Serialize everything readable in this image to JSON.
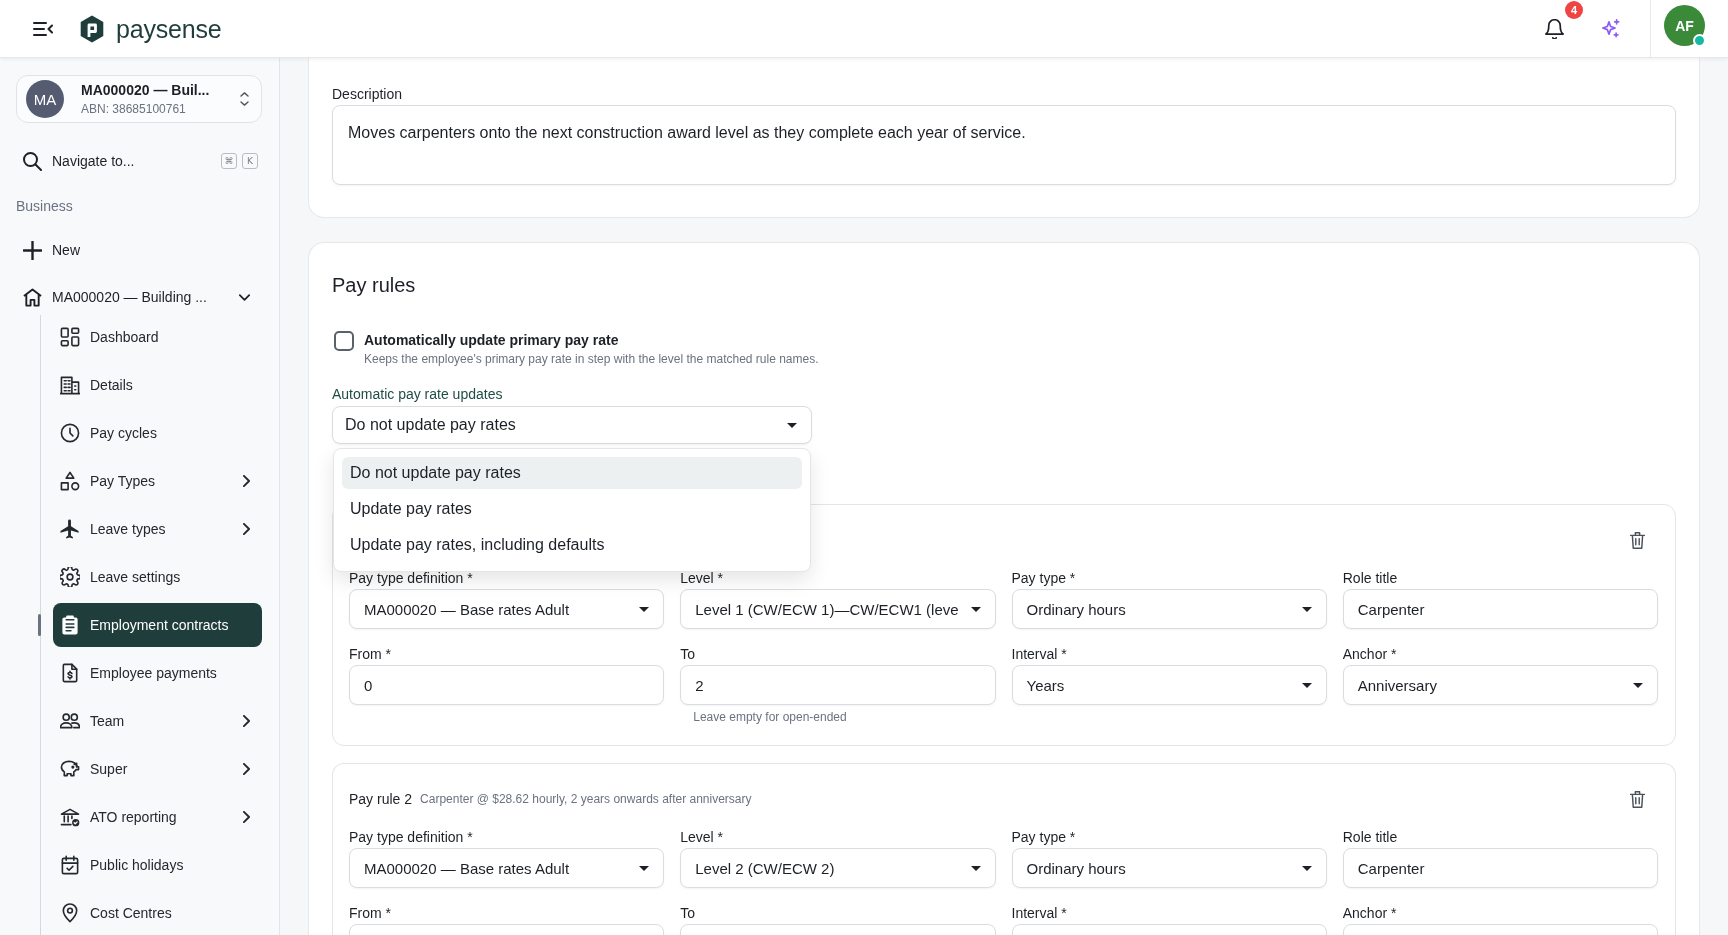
{
  "header": {
    "logo_text": "paysense",
    "notification_count": "4",
    "user": {
      "initials": "AF",
      "online": true
    }
  },
  "sidebar": {
    "org": {
      "initials": "MA",
      "name": "MA000020 — Buil...",
      "abn": "ABN: 38685100761"
    },
    "navigate": {
      "label": "Navigate to...",
      "shortcut": [
        "⌘",
        "K"
      ]
    },
    "section_label": "Business",
    "new_label": "New",
    "group": {
      "label": "MA000020 — Building ...",
      "expanded": true,
      "children": [
        {
          "label": "Dashboard",
          "submenu": false,
          "selected": false
        },
        {
          "label": "Details",
          "submenu": false,
          "selected": false
        },
        {
          "label": "Pay cycles",
          "submenu": false,
          "selected": false
        },
        {
          "label": "Pay Types",
          "submenu": true,
          "selected": false
        },
        {
          "label": "Leave types",
          "submenu": true,
          "selected": false
        },
        {
          "label": "Leave settings",
          "submenu": false,
          "selected": false
        },
        {
          "label": "Employment contracts",
          "submenu": false,
          "selected": true
        },
        {
          "label": "Employee payments",
          "submenu": false,
          "selected": false
        },
        {
          "label": "Team",
          "submenu": true,
          "selected": false
        },
        {
          "label": "Super",
          "submenu": true,
          "selected": false
        },
        {
          "label": "ATO reporting",
          "submenu": true,
          "selected": false
        },
        {
          "label": "Public holidays",
          "submenu": false,
          "selected": false
        },
        {
          "label": "Cost Centres",
          "submenu": false,
          "selected": false
        }
      ]
    }
  },
  "description": {
    "label": "Description",
    "value": "Moves carpenters onto the next construction award level as they complete each year of service."
  },
  "pay_rules": {
    "title": "Pay rules",
    "auto_update": {
      "label": "Automatically update primary pay rate",
      "hint": "Keeps the employee's primary pay rate in step with the level the matched rule names.",
      "checked": false
    },
    "rate_updates": {
      "label": "Automatic pay rate updates",
      "value": "Do not update pay rates",
      "open": true,
      "options": [
        {
          "label": "Do not update pay rates",
          "selected": true
        },
        {
          "label": "Update pay rates",
          "selected": false
        },
        {
          "label": "Update pay rates, including defaults",
          "selected": false
        }
      ]
    },
    "rules": [
      {
        "fields": [
          {
            "label": "Pay type definition *",
            "kind": "select",
            "value": "MA000020 — Base rates Adult"
          },
          {
            "label": "Level *",
            "kind": "select",
            "value": "Level 1 (CW/ECW 1)—CW/ECW1 (leve"
          },
          {
            "label": "Pay type *",
            "kind": "select",
            "value": "Ordinary hours"
          },
          {
            "label": "Role title",
            "kind": "text",
            "value": "Carpenter"
          },
          {
            "label": "From *",
            "kind": "text",
            "value": "0"
          },
          {
            "label": "To",
            "kind": "text",
            "value": "2",
            "hint": "Leave empty for open-ended"
          },
          {
            "label": "Interval *",
            "kind": "select",
            "value": "Years"
          },
          {
            "label": "Anchor *",
            "kind": "select",
            "value": "Anniversary"
          }
        ]
      },
      {
        "title": "Pay rule 2",
        "summary": "Carpenter @ $28.62 hourly, 2 years onwards after anniversary",
        "fields": [
          {
            "label": "Pay type definition *",
            "kind": "select",
            "value": "MA000020 — Base rates Adult"
          },
          {
            "label": "Level *",
            "kind": "select",
            "value": "Level 2 (CW/ECW 2)"
          },
          {
            "label": "Pay type *",
            "kind": "select",
            "value": "Ordinary hours"
          },
          {
            "label": "Role title",
            "kind": "text",
            "value": "Carpenter"
          },
          {
            "label": "From *",
            "kind": "text"
          },
          {
            "label": "To",
            "kind": "text"
          },
          {
            "label": "Interval *",
            "kind": "select"
          },
          {
            "label": "Anchor *",
            "kind": "select"
          }
        ]
      }
    ]
  }
}
